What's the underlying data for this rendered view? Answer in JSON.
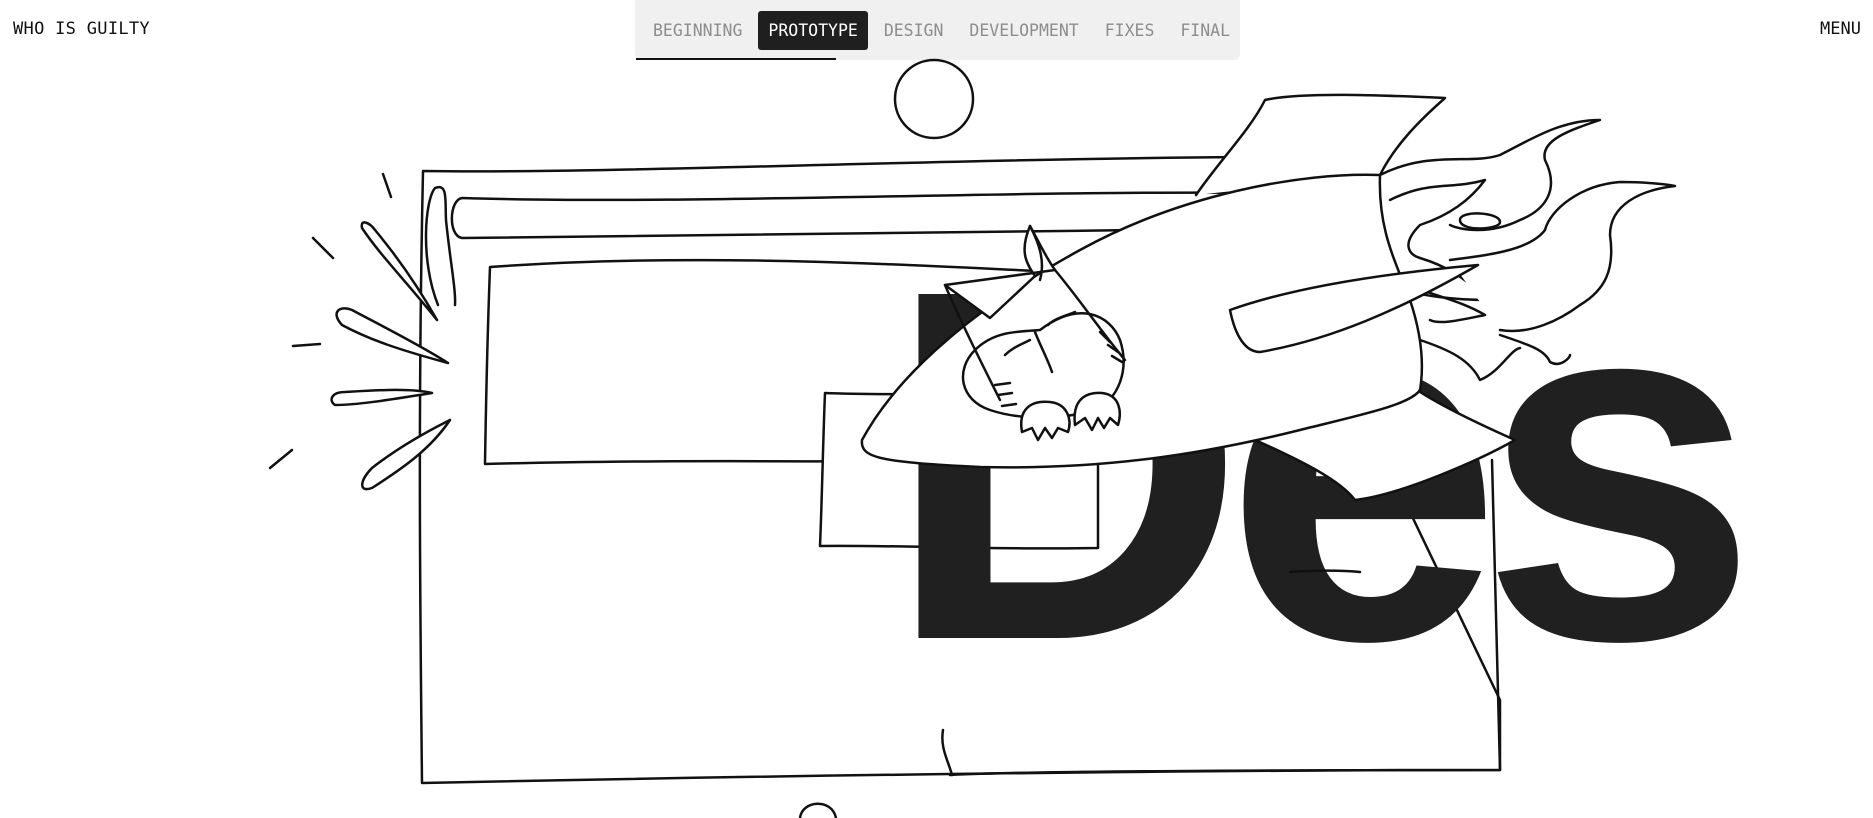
{
  "header": {
    "brand": "WHO IS GUILTY",
    "menu_label": "MENU"
  },
  "tabs": [
    {
      "label": "BEGINNING",
      "active": false
    },
    {
      "label": "PROTOTYPE",
      "active": true
    },
    {
      "label": "DESIGN",
      "active": false
    },
    {
      "label": "DEVELOPMENT",
      "active": false
    },
    {
      "label": "FIXES",
      "active": false
    },
    {
      "label": "FINAL",
      "active": false
    }
  ],
  "progress": {
    "fraction": 0.33
  },
  "hero": {
    "word": "Des"
  },
  "colors": {
    "ink": "#111111",
    "dark": "#202020",
    "tab_bg": "#f0f0f0",
    "tab_inactive": "#8d8d8d"
  }
}
